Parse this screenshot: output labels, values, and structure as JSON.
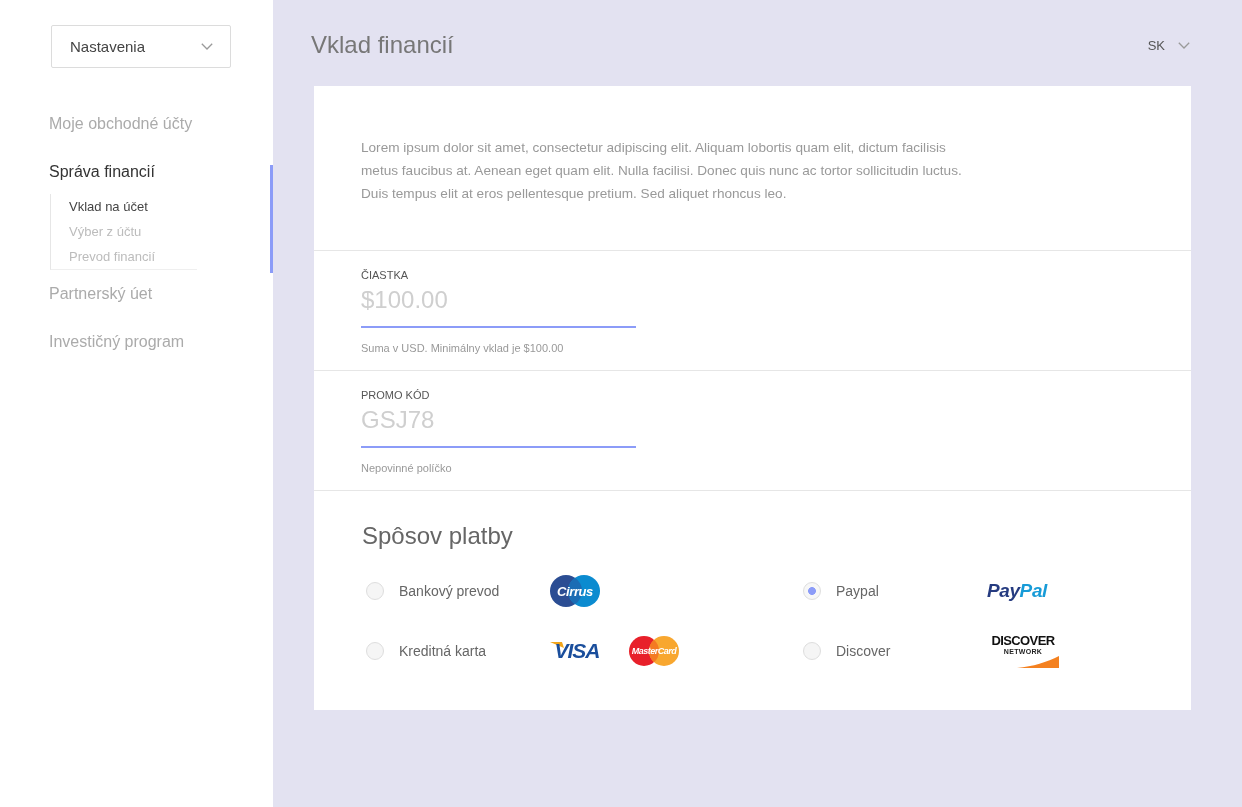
{
  "sidebar": {
    "dropdown": {
      "label": "Nastavenia"
    },
    "items": [
      {
        "label": "Moje obchodné účty",
        "selected": false
      },
      {
        "label": "Správa financií",
        "selected": true,
        "expanded": true,
        "children": [
          {
            "label": "Vklad na účet",
            "selected": true
          },
          {
            "label": "Výber z účtu",
            "selected": false
          },
          {
            "label": "Prevod financií",
            "selected": false
          }
        ]
      },
      {
        "label": "Partnerský úet",
        "selected": false
      },
      {
        "label": "Investičný program",
        "selected": false
      }
    ]
  },
  "header": {
    "title": "Vklad financií",
    "language": "SK"
  },
  "intro": "Lorem ipsum dolor sit amet, consectetur adipiscing elit. Aliquam lobortis quam elit, dictum facilisis metus faucibus at. Aenean eget quam elit. Nulla facilisi. Donec quis nunc ac tortor sollicitudin luctus. Duis tempus elit at eros pellentesque pretium. Sed aliquet rhoncus leo.",
  "fields": [
    {
      "label": "ČIASTKA",
      "placeholder": "$100.00",
      "hint": "Suma v USD. Minimálny vklad je $100.00"
    },
    {
      "label": "PROMO KÓD",
      "placeholder": "GSJ78",
      "hint": "Nepovinné políčko"
    }
  ],
  "payment": {
    "title": "Spôsov platby",
    "methods": [
      {
        "label": "Bankový prevod",
        "selected": false,
        "logos": [
          {
            "kind": "cirrus",
            "text": "Cirrus"
          }
        ]
      },
      {
        "label": "Kreditná karta",
        "selected": false,
        "logos": [
          {
            "kind": "visa",
            "text": "VISA"
          },
          {
            "kind": "mastercard",
            "text": "MasterCard"
          }
        ]
      },
      {
        "label": "Paypal",
        "selected": true,
        "logos": [
          {
            "kind": "paypal",
            "parts": [
              "Pay",
              "Pal"
            ]
          }
        ]
      },
      {
        "label": "Discover",
        "selected": false,
        "logos": [
          {
            "kind": "discover",
            "text": "DISCOVER",
            "subtext": "NETWORK"
          }
        ]
      }
    ]
  }
}
